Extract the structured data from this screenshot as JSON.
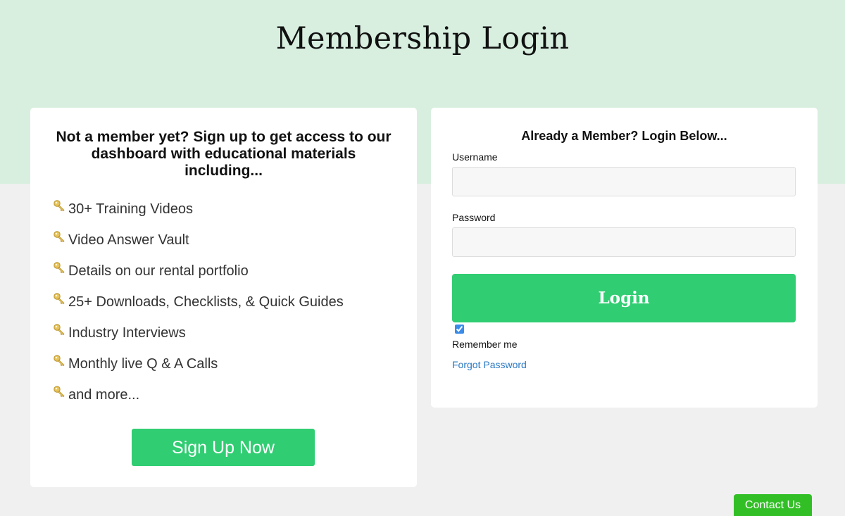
{
  "page": {
    "title": "Membership Login"
  },
  "signup": {
    "heading": "Not a member yet? Sign up to get access to our dashboard with educational materials including...",
    "benefits": [
      "30+ Training Videos",
      "Video Answer Vault",
      "Details on our rental portfolio",
      "25+ Downloads, Checklists, & Quick Guides",
      "Industry Interviews",
      "Monthly live Q & A Calls",
      "and more..."
    ],
    "bullet_icon": "key-icon",
    "button_label": "Sign Up Now"
  },
  "login": {
    "heading": "Already a Member? Login Below...",
    "username_label": "Username",
    "username_value": "",
    "password_label": "Password",
    "password_value": "",
    "button_label": "Login",
    "remember_checked": true,
    "remember_label": "Remember me",
    "forgot_link": "Forgot Password"
  },
  "contact": {
    "button_label": "Contact Us"
  },
  "colors": {
    "hero_background": "#d8efdf",
    "page_background": "#f0f0f0",
    "primary_button": "#30cd72",
    "contact_button": "#32bf26",
    "link": "#2a78c2"
  }
}
